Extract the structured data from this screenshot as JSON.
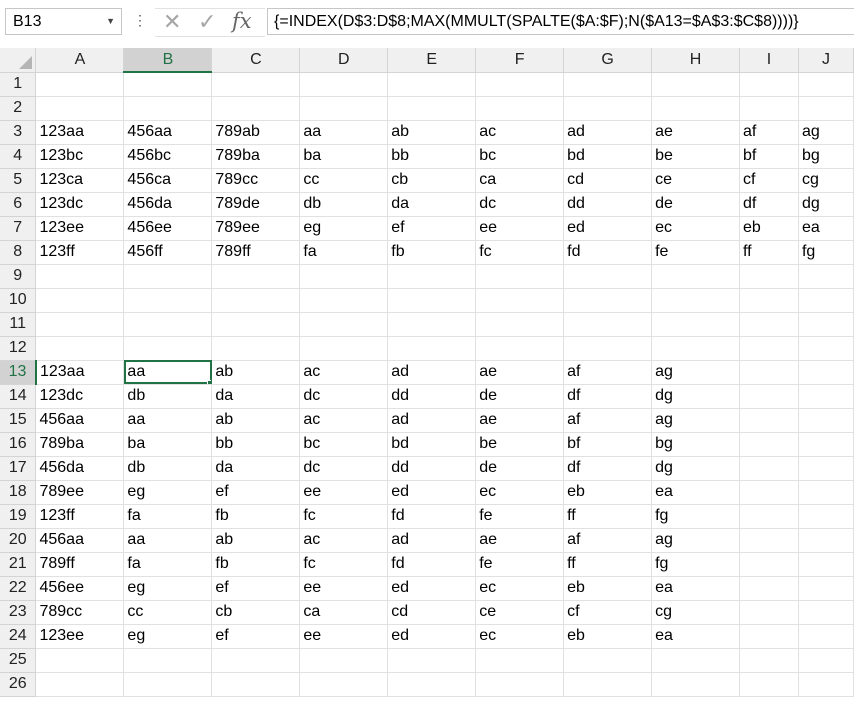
{
  "name_box": "B13",
  "formula": "{=INDEX(D$3:D$8;MAX(MMULT(SPALTE($A:$F);N($A13=$A$3:$C$8))))}",
  "fx_label": "fx",
  "selected_cell": "B13",
  "columns": [
    "A",
    "B",
    "C",
    "D",
    "E",
    "F",
    "G",
    "H",
    "I",
    "J"
  ],
  "rows": [
    {
      "n": "1",
      "cells": [
        "",
        "",
        "",
        "",
        "",
        "",
        "",
        "",
        "",
        ""
      ]
    },
    {
      "n": "2",
      "cells": [
        "",
        "",
        "",
        "",
        "",
        "",
        "",
        "",
        "",
        ""
      ]
    },
    {
      "n": "3",
      "cells": [
        "123aa",
        "456aa",
        "789ab",
        "aa",
        "ab",
        "ac",
        "ad",
        "ae",
        "af",
        "ag"
      ]
    },
    {
      "n": "4",
      "cells": [
        "123bc",
        "456bc",
        "789ba",
        "ba",
        "bb",
        "bc",
        "bd",
        "be",
        "bf",
        "bg"
      ]
    },
    {
      "n": "5",
      "cells": [
        "123ca",
        "456ca",
        "789cc",
        "cc",
        "cb",
        "ca",
        "cd",
        "ce",
        "cf",
        "cg"
      ]
    },
    {
      "n": "6",
      "cells": [
        "123dc",
        "456da",
        "789de",
        "db",
        "da",
        "dc",
        "dd",
        "de",
        "df",
        "dg"
      ]
    },
    {
      "n": "7",
      "cells": [
        "123ee",
        "456ee",
        "789ee",
        "eg",
        "ef",
        "ee",
        "ed",
        "ec",
        "eb",
        "ea"
      ]
    },
    {
      "n": "8",
      "cells": [
        "123ff",
        "456ff",
        "789ff",
        "fa",
        "fb",
        "fc",
        "fd",
        "fe",
        "ff",
        "fg"
      ]
    },
    {
      "n": "9",
      "cells": [
        "",
        "",
        "",
        "",
        "",
        "",
        "",
        "",
        "",
        ""
      ]
    },
    {
      "n": "10",
      "cells": [
        "",
        "",
        "",
        "",
        "",
        "",
        "",
        "",
        "",
        ""
      ]
    },
    {
      "n": "11",
      "cells": [
        "",
        "",
        "",
        "",
        "",
        "",
        "",
        "",
        "",
        ""
      ]
    },
    {
      "n": "12",
      "cells": [
        "",
        "",
        "",
        "",
        "",
        "",
        "",
        "",
        "",
        ""
      ]
    },
    {
      "n": "13",
      "cells": [
        "123aa",
        "aa",
        "ab",
        "ac",
        "ad",
        "ae",
        "af",
        "ag",
        "",
        ""
      ]
    },
    {
      "n": "14",
      "cells": [
        "123dc",
        "db",
        "da",
        "dc",
        "dd",
        "de",
        "df",
        "dg",
        "",
        ""
      ]
    },
    {
      "n": "15",
      "cells": [
        "456aa",
        "aa",
        "ab",
        "ac",
        "ad",
        "ae",
        "af",
        "ag",
        "",
        ""
      ]
    },
    {
      "n": "16",
      "cells": [
        "789ba",
        "ba",
        "bb",
        "bc",
        "bd",
        "be",
        "bf",
        "bg",
        "",
        ""
      ]
    },
    {
      "n": "17",
      "cells": [
        "456da",
        "db",
        "da",
        "dc",
        "dd",
        "de",
        "df",
        "dg",
        "",
        ""
      ]
    },
    {
      "n": "18",
      "cells": [
        "789ee",
        "eg",
        "ef",
        "ee",
        "ed",
        "ec",
        "eb",
        "ea",
        "",
        ""
      ]
    },
    {
      "n": "19",
      "cells": [
        "123ff",
        "fa",
        "fb",
        "fc",
        "fd",
        "fe",
        "ff",
        "fg",
        "",
        ""
      ]
    },
    {
      "n": "20",
      "cells": [
        "456aa",
        "aa",
        "ab",
        "ac",
        "ad",
        "ae",
        "af",
        "ag",
        "",
        ""
      ]
    },
    {
      "n": "21",
      "cells": [
        "789ff",
        "fa",
        "fb",
        "fc",
        "fd",
        "fe",
        "ff",
        "fg",
        "",
        ""
      ]
    },
    {
      "n": "22",
      "cells": [
        "456ee",
        "eg",
        "ef",
        "ee",
        "ed",
        "ec",
        "eb",
        "ea",
        "",
        ""
      ]
    },
    {
      "n": "23",
      "cells": [
        "789cc",
        "cc",
        "cb",
        "ca",
        "cd",
        "ce",
        "cf",
        "cg",
        "",
        ""
      ]
    },
    {
      "n": "24",
      "cells": [
        "123ee",
        "eg",
        "ef",
        "ee",
        "ed",
        "ec",
        "eb",
        "ea",
        "",
        ""
      ]
    },
    {
      "n": "25",
      "cells": [
        "",
        "",
        "",
        "",
        "",
        "",
        "",
        "",
        "",
        ""
      ]
    },
    {
      "n": "26",
      "cells": [
        "",
        "",
        "",
        "",
        "",
        "",
        "",
        "",
        "",
        ""
      ]
    }
  ],
  "icons": {
    "name_dropdown": "chevron-down-icon",
    "cancel": "close-icon",
    "enter": "check-icon",
    "insert_function": "fx-icon"
  },
  "colors": {
    "selection": "#217346",
    "header_bg": "#f0f0f0",
    "header_selected_bg": "#d2d2d2",
    "gridline": "#e1e1e1"
  }
}
